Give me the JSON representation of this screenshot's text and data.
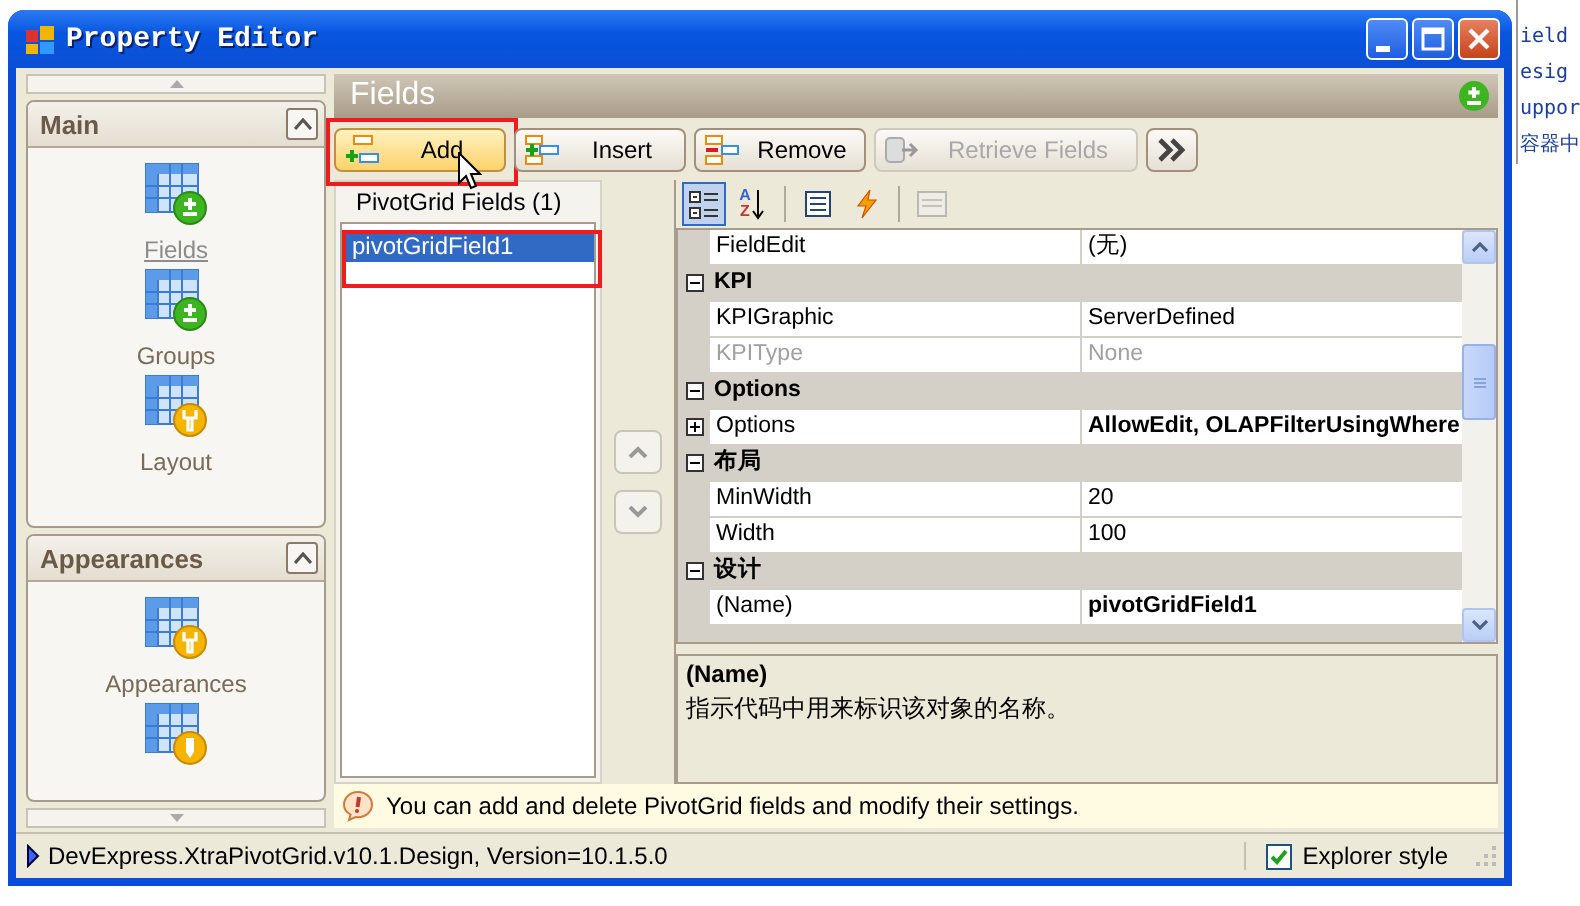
{
  "background": {
    "side_lines": [
      "ield",
      "esig",
      "uppor",
      "容器中"
    ]
  },
  "window": {
    "title": "Property Editor"
  },
  "navbar": {
    "groups": [
      {
        "title": "Main",
        "expanded": true,
        "items": [
          {
            "label": "Fields",
            "kind": "add",
            "selected": true
          },
          {
            "label": "Groups",
            "kind": "add",
            "selected": false
          },
          {
            "label": "Layout",
            "kind": "customize",
            "selected": false
          }
        ]
      },
      {
        "title": "Appearances",
        "expanded": true,
        "items": [
          {
            "label": "Appearances",
            "kind": "customize",
            "selected": false
          },
          {
            "kind": "format",
            "selected": false
          }
        ]
      }
    ]
  },
  "page": {
    "title": "Fields"
  },
  "toolbar": {
    "buttons": [
      {
        "label": "Add",
        "kind": "add",
        "hot": true,
        "disabled": false,
        "highlighted": true
      },
      {
        "label": "Insert",
        "kind": "insert",
        "hot": false,
        "disabled": false,
        "highlighted": false
      },
      {
        "label": "Remove",
        "kind": "remove",
        "hot": false,
        "disabled": false,
        "highlighted": false
      },
      {
        "label": "Retrieve Fields",
        "kind": "retrieve",
        "hot": false,
        "disabled": true,
        "highlighted": false
      },
      {
        "kind": "more",
        "hot": false,
        "disabled": false,
        "highlighted": false
      }
    ]
  },
  "field_list": {
    "title": "PivotGrid Fields (1)",
    "items": [
      {
        "label": "pivotGridField1",
        "selected": true,
        "highlighted": true
      }
    ]
  },
  "property_grid": {
    "tools": [
      {
        "kind": "categorized",
        "selected": true,
        "disabled": false
      },
      {
        "kind": "alphabetical",
        "letters": [
          "A",
          "Z"
        ],
        "selected": false,
        "disabled": false
      },
      {
        "kind": "properties",
        "selected": false,
        "disabled": false
      },
      {
        "kind": "events",
        "selected": false,
        "disabled": false
      },
      {
        "kind": "pages",
        "selected": false,
        "disabled": true
      }
    ],
    "rows": [
      {
        "kind": "property",
        "name": "FieldEdit",
        "value": "(无)",
        "modified": false,
        "disabled": false
      },
      {
        "kind": "category",
        "label": "KPI",
        "expanded": true
      },
      {
        "kind": "property",
        "name": "KPIGraphic",
        "value": "ServerDefined",
        "modified": false,
        "disabled": false
      },
      {
        "kind": "property",
        "name": "KPIType",
        "value": "None",
        "modified": false,
        "disabled": true
      },
      {
        "kind": "category",
        "label": "Options",
        "expanded": true
      },
      {
        "kind": "property",
        "name": "Options",
        "value": "AllowEdit, OLAPFilterUsingWhere",
        "modified": true,
        "disabled": false,
        "expandable": true,
        "expanded": false
      },
      {
        "kind": "category",
        "label": "布局",
        "expanded": true
      },
      {
        "kind": "property",
        "name": "MinWidth",
        "value": "20",
        "modified": false,
        "disabled": false
      },
      {
        "kind": "property",
        "name": "Width",
        "value": "100",
        "modified": false,
        "disabled": false
      },
      {
        "kind": "category",
        "label": "设计",
        "expanded": true
      },
      {
        "kind": "property",
        "name": "(Name)",
        "value": "pivotGridField1",
        "modified": true,
        "disabled": false
      }
    ],
    "description": {
      "title": "(Name)",
      "text": "指示代码中用来标识该对象的名称。"
    }
  },
  "hint": "You can add and delete PivotGrid fields and modify their settings.",
  "status_bar": {
    "text": "DevExpress.XtraPivotGrid.v10.1.Design, Version=10.1.5.0",
    "explorer_style": {
      "label": "Explorer style",
      "checked": true
    }
  }
}
